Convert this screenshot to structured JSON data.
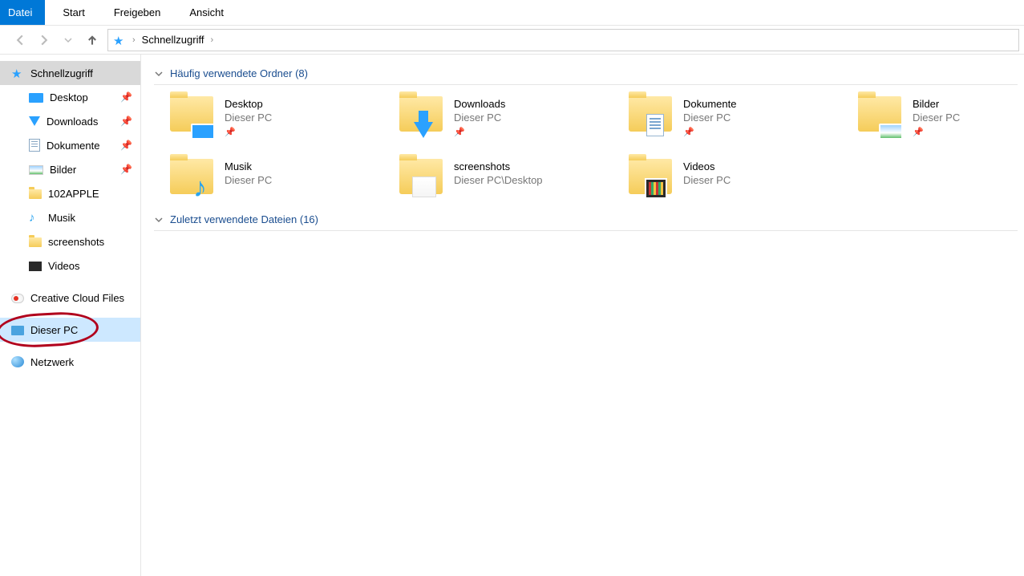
{
  "ribbon": {
    "file": "Datei",
    "start": "Start",
    "share": "Freigeben",
    "view": "Ansicht"
  },
  "breadcrumb": {
    "root": "Schnellzugriff"
  },
  "sidebar": {
    "quick_access": "Schnellzugriff",
    "desktop": "Desktop",
    "downloads": "Downloads",
    "documents": "Dokumente",
    "pictures": "Bilder",
    "apple": "102APPLE",
    "music": "Musik",
    "screenshots": "screenshots",
    "videos": "Videos",
    "creative_cloud": "Creative Cloud Files",
    "this_pc": "Dieser PC",
    "network": "Netzwerk"
  },
  "groups": {
    "frequent": "Häufig verwendete Ordner (8)",
    "recent": "Zuletzt verwendete Dateien (16)"
  },
  "tiles": {
    "desktop": {
      "title": "Desktop",
      "sub": "Dieser PC",
      "pinned": true
    },
    "downloads": {
      "title": "Downloads",
      "sub": "Dieser PC",
      "pinned": true
    },
    "documents": {
      "title": "Dokumente",
      "sub": "Dieser PC",
      "pinned": true
    },
    "pictures": {
      "title": "Bilder",
      "sub": "Dieser PC",
      "pinned": true
    },
    "music": {
      "title": "Musik",
      "sub": "Dieser PC",
      "pinned": false
    },
    "screenshots": {
      "title": "screenshots",
      "sub": "Dieser PC\\Desktop",
      "pinned": false
    },
    "videos": {
      "title": "Videos",
      "sub": "Dieser PC",
      "pinned": false
    }
  }
}
